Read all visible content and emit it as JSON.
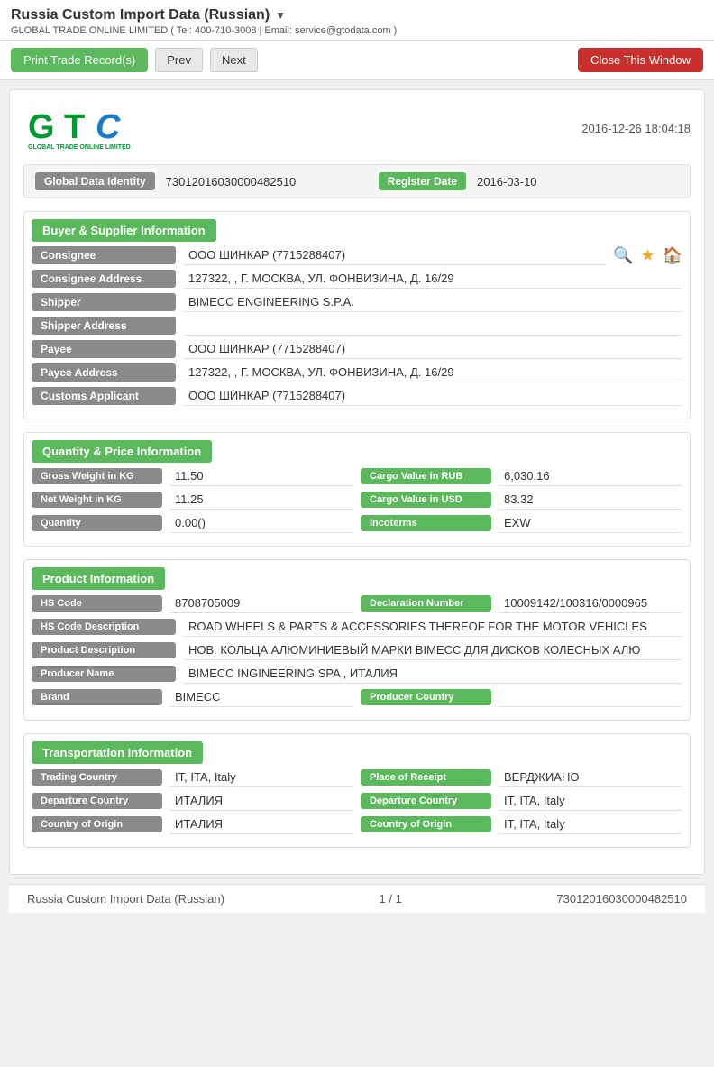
{
  "page": {
    "title": "Russia Custom Import Data (Russian)",
    "subtitle": "GLOBAL TRADE ONLINE LIMITED ( Tel: 400-710-3008 | Email: service@gtodata.com )"
  },
  "toolbar": {
    "print_label": "Print Trade Record(s)",
    "prev_label": "Prev",
    "next_label": "Next",
    "close_label": "Close This Window"
  },
  "record": {
    "timestamp": "2016-12-26 18:04:18",
    "logo_company": "GLOBAL TRADE ONLINE LIMITED",
    "global_data_identity_label": "Global Data Identity",
    "global_data_identity_value": "73012016030000482510",
    "register_date_label": "Register Date",
    "register_date_value": "2016-03-10"
  },
  "buyer_supplier": {
    "section_title": "Buyer & Supplier Information",
    "consignee_label": "Consignee",
    "consignee_value": "ООО ШИНКАР  (7715288407)",
    "consignee_address_label": "Consignee Address",
    "consignee_address_value": "127322, , Г. МОСКВА, УЛ. ФОНВИЗИНА, Д. 16/29",
    "shipper_label": "Shipper",
    "shipper_value": "BIMECC ENGINEERING S.P.A.",
    "shipper_address_label": "Shipper Address",
    "shipper_address_value": "",
    "payee_label": "Payee",
    "payee_value": "ООО ШИНКАР  (7715288407)",
    "payee_address_label": "Payee Address",
    "payee_address_value": "127322, , Г. МОСКВА, УЛ. ФОНВИЗИНА, Д. 16/29",
    "customs_applicant_label": "Customs Applicant",
    "customs_applicant_value": "ООО ШИНКАР  (7715288407)"
  },
  "quantity_price": {
    "section_title": "Quantity & Price Information",
    "gross_weight_label": "Gross Weight in KG",
    "gross_weight_value": "11.50",
    "cargo_value_rub_label": "Cargo Value in RUB",
    "cargo_value_rub_value": "6,030.16",
    "net_weight_label": "Net Weight in KG",
    "net_weight_value": "11.25",
    "cargo_value_usd_label": "Cargo Value in USD",
    "cargo_value_usd_value": "83.32",
    "quantity_label": "Quantity",
    "quantity_value": "0.00()",
    "incoterms_label": "Incoterms",
    "incoterms_value": "EXW"
  },
  "product": {
    "section_title": "Product Information",
    "hs_code_label": "HS Code",
    "hs_code_value": "8708705009",
    "declaration_number_label": "Declaration Number",
    "declaration_number_value": "10009142/100316/0000965",
    "hs_code_desc_label": "HS Code Description",
    "hs_code_desc_value": "ROAD WHEELS & PARTS & ACCESSORIES THEREOF FOR THE MOTOR VEHICLES",
    "product_desc_label": "Product Description",
    "product_desc_value": "НОВ. КОЛЬЦА АЛЮМИНИЕВЫЙ МАРКИ BIMECC ДЛЯ ДИСКОВ КОЛЕСНЫХ АЛЮ",
    "producer_name_label": "Producer Name",
    "producer_name_value": "BIMECC INGINEERING SPA , ИТАЛИЯ",
    "brand_label": "Brand",
    "brand_value": "BIMECC",
    "producer_country_label": "Producer Country",
    "producer_country_value": ""
  },
  "transportation": {
    "section_title": "Transportation Information",
    "trading_country_label": "Trading Country",
    "trading_country_value": "IT, ITA, Italy",
    "place_of_receipt_label": "Place of Receipt",
    "place_of_receipt_value": "ВЕРДЖИАНО",
    "departure_country_left_label": "Departure Country",
    "departure_country_left_value": "ИТАЛИЯ",
    "departure_country_right_label": "Departure Country",
    "departure_country_right_value": "IT, ITA, Italy",
    "country_of_origin_left_label": "Country of Origin",
    "country_of_origin_left_value": "ИТАЛИЯ",
    "country_of_origin_right_label": "Country of Origin",
    "country_of_origin_right_value": "IT, ITA, Italy"
  },
  "footer": {
    "left": "Russia Custom Import Data (Russian)",
    "center": "1 / 1",
    "right": "73012016030000482510"
  }
}
